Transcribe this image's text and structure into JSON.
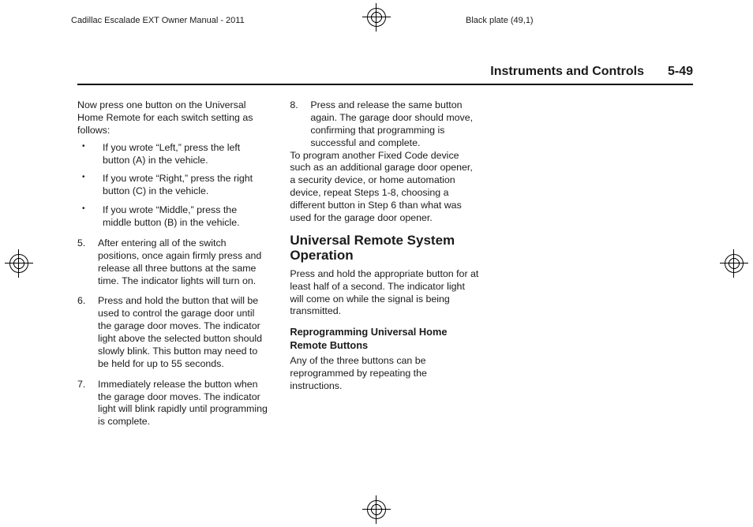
{
  "print": {
    "left_label": "Cadillac Escalade EXT Owner Manual - 2011",
    "right_label": "Black plate (49,1)"
  },
  "header": {
    "chapter": "Instruments and Controls",
    "page": "5-49"
  },
  "col1": {
    "intro": "Now press one button on the Universal Home Remote for each switch setting as follows:",
    "bullets": [
      "If you wrote “Left,” press the left button (A) in the vehicle.",
      "If you wrote “Right,” press the right button (C) in the vehicle.",
      "If you wrote “Middle,” press the middle button (B) in the vehicle."
    ],
    "step5_num": "5.",
    "step5": "After entering all of the switch positions, once again firmly press and release all three buttons at the same time. The indicator lights will turn on."
  },
  "col2": {
    "step6_num": "6.",
    "step6": "Press and hold the button that will be used to control the garage door until the garage door moves. The indicator light above the selected button should slowly blink. This button may need to be held for up to 55 seconds.",
    "step7_num": "7.",
    "step7": "Immediately release the button when the garage door moves. The indicator light will blink rapidly until programming is complete.",
    "step8_num": "8.",
    "step8": "Press and release the same button again. The garage door should move, confirming that programming is successful and complete."
  },
  "col3": {
    "para1": "To program another Fixed Code device such as an additional garage door opener, a security device, or home automation device, repeat Steps 1-8, choosing a different button in Step 6 than what was used for the garage door opener.",
    "h2": "Universal Remote System Operation",
    "para2": "Press and hold the appropriate button for at least half of a second. The indicator light will come on while the signal is being transmitted.",
    "subhead": "Reprogramming Universal Home Remote Buttons",
    "para3": "Any of the three buttons can be reprogrammed by repeating the instructions."
  }
}
